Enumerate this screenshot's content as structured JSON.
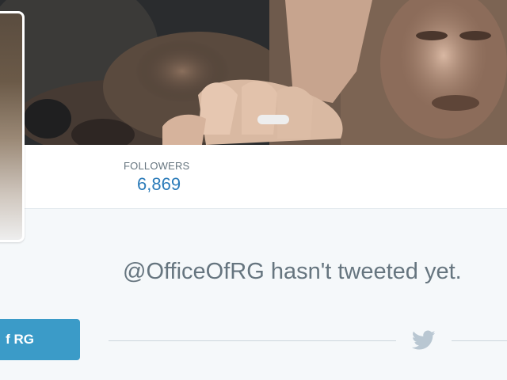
{
  "profile": {
    "stats": {
      "followers_label": "FOLLOWERS",
      "followers_count": "6,869"
    },
    "timeline": {
      "empty_message": "@OfficeOfRG hasn't tweeted yet."
    },
    "button": {
      "label": "f RG"
    }
  },
  "icons": {
    "divider_icon": "bird-icon"
  },
  "colors": {
    "accent": "#2b7bb9",
    "button": "#3b9bc8",
    "muted_text": "#66757f",
    "background": "#f5f8fa",
    "divider": "#ccd6dd"
  }
}
